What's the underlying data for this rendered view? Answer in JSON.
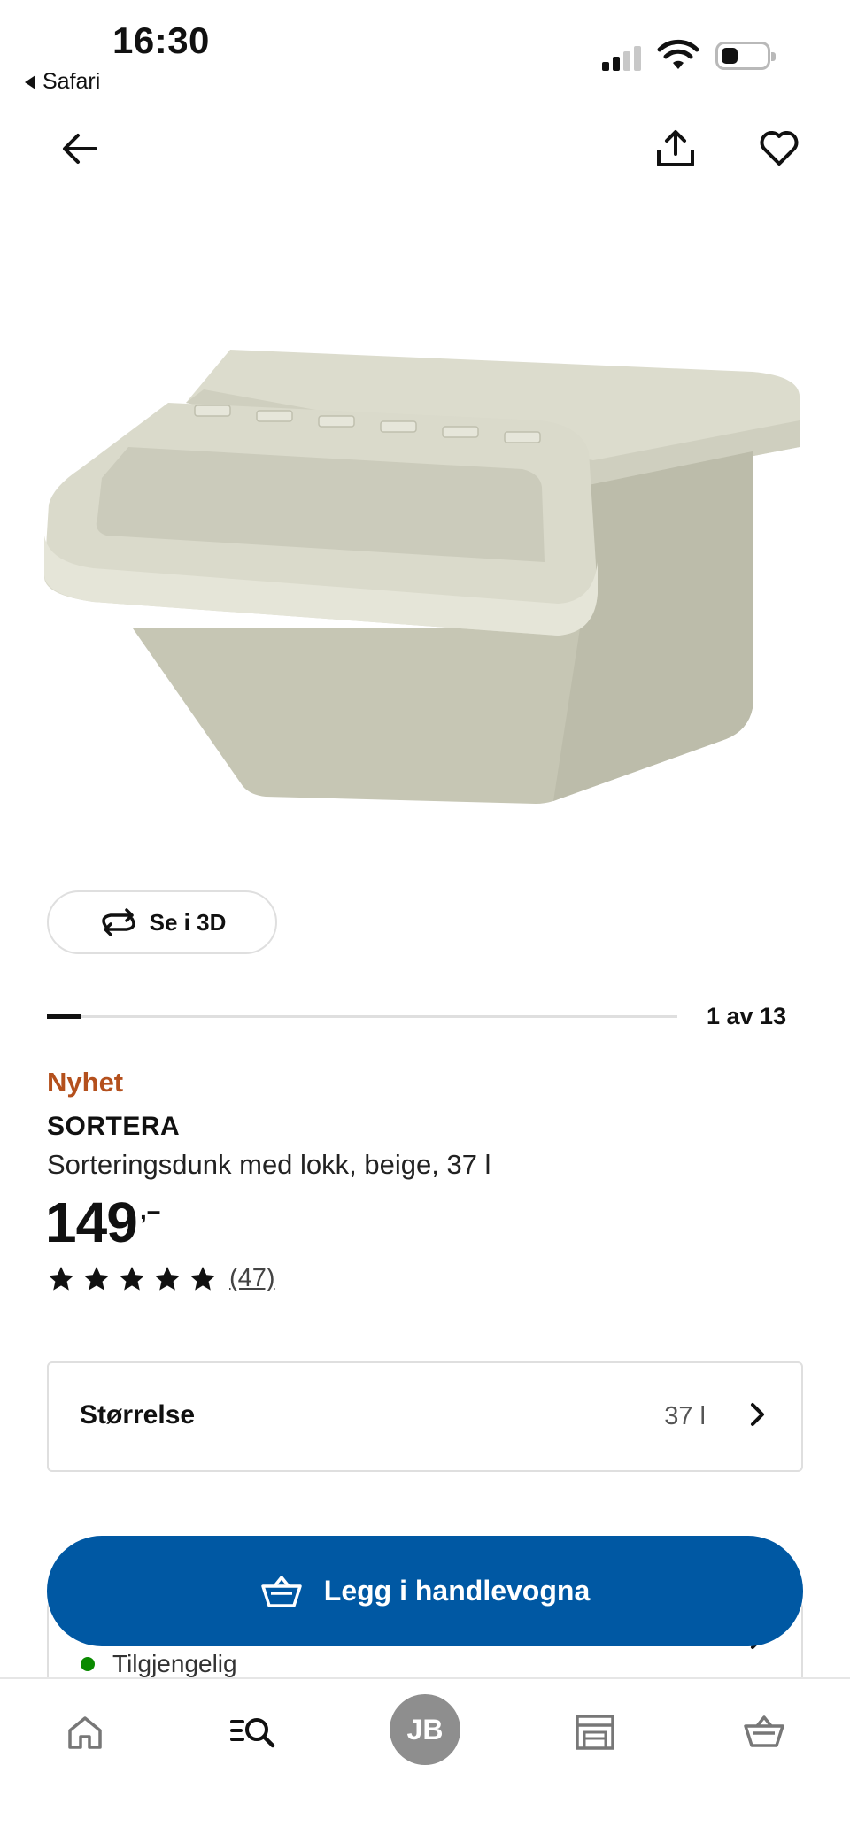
{
  "status_bar": {
    "time": "16:30",
    "back_app": "Safari"
  },
  "top_nav": {
    "back_icon": "arrow-left-icon",
    "share_icon": "share-icon",
    "favorite_icon": "heart-icon"
  },
  "gallery": {
    "view_3d_label": "Se i 3D",
    "view_3d_icon": "rotate-3d-icon",
    "position_label": "1 av 13",
    "current_image": 1,
    "total_images": 13
  },
  "product": {
    "badge": "Nyhet",
    "name": "SORTERA",
    "description": "Sorteringsdunk med lokk, beige, 37 l",
    "price": "149",
    "price_suffix": ",–",
    "rating_stars": 5,
    "review_count": "(47)"
  },
  "size_selector": {
    "label": "Størrelse",
    "value": "37 l"
  },
  "add_to_cart": {
    "label": "Legg i handlevogna",
    "icon": "basket-icon"
  },
  "availability": {
    "text": "Tilgjengelig"
  },
  "tab_bar": {
    "items": [
      {
        "name": "home",
        "icon": "home-icon"
      },
      {
        "name": "search",
        "icon": "search-icon"
      },
      {
        "name": "profile",
        "initials": "JB"
      },
      {
        "name": "store",
        "icon": "store-icon"
      },
      {
        "name": "cart",
        "icon": "basket-icon"
      }
    ]
  },
  "colors": {
    "accent_blue": "#0058a3",
    "new_badge": "#b4501d",
    "available_green": "#0a8a00",
    "product_beige": "#d2d2c3"
  }
}
